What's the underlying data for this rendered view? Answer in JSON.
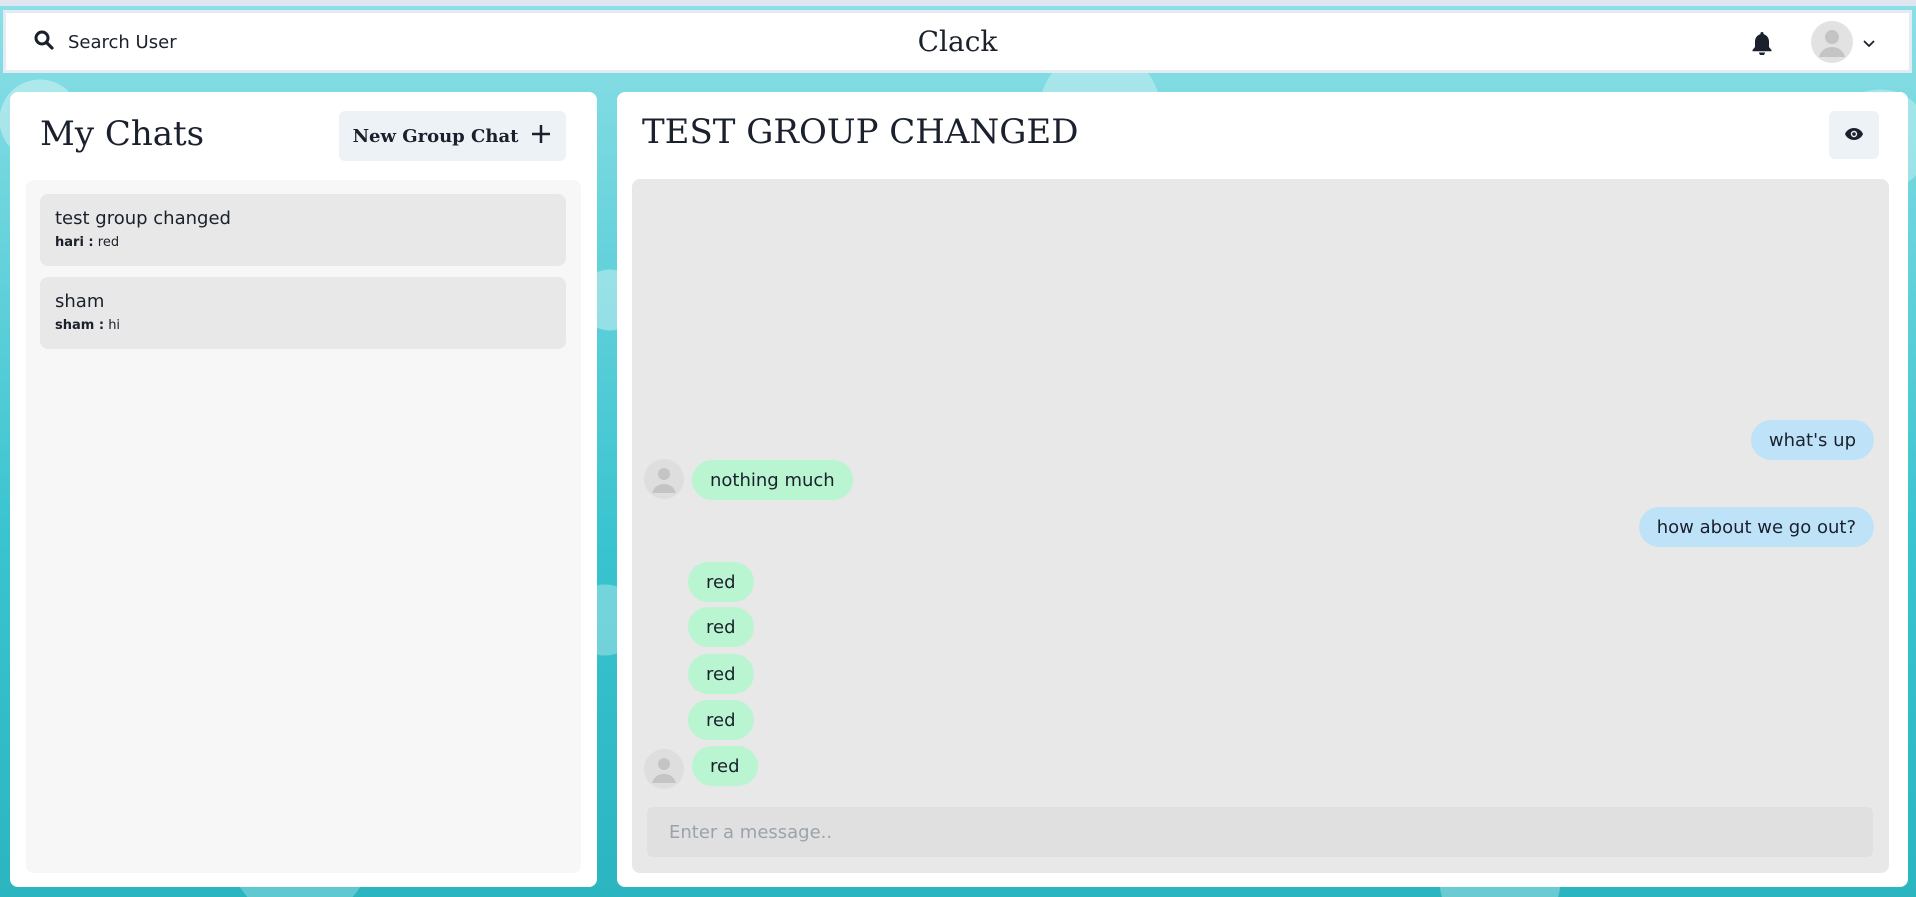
{
  "header": {
    "search_label": "Search User",
    "app_title": "Clack"
  },
  "sidebar": {
    "title": "My Chats",
    "new_group_label": "New Group Chat",
    "chats": [
      {
        "name": "test group changed",
        "sender": "hari :",
        "preview": "red"
      },
      {
        "name": "sham",
        "sender": "sham :",
        "preview": "hi"
      }
    ]
  },
  "chat": {
    "title": "TEST GROUP CHANGED",
    "messages": [
      {
        "text": "what's up",
        "mine": true
      },
      {
        "text": "nothing much",
        "mine": false
      },
      {
        "text": "how about we go out?",
        "mine": true
      },
      {
        "text": "red",
        "mine": false
      },
      {
        "text": "red",
        "mine": false
      },
      {
        "text": "red",
        "mine": false
      },
      {
        "text": "red",
        "mine": false
      },
      {
        "text": "red",
        "mine": false
      }
    ],
    "input_placeholder": "Enter a message.."
  },
  "colors": {
    "my_bubble": "#bee3f8",
    "their_bubble": "#b9f5d0",
    "background_accent": "#2bbfc9"
  },
  "icons": [
    "search-icon",
    "bell-icon",
    "user-avatar-icon",
    "chevron-down-icon",
    "plus-icon",
    "eye-icon"
  ]
}
